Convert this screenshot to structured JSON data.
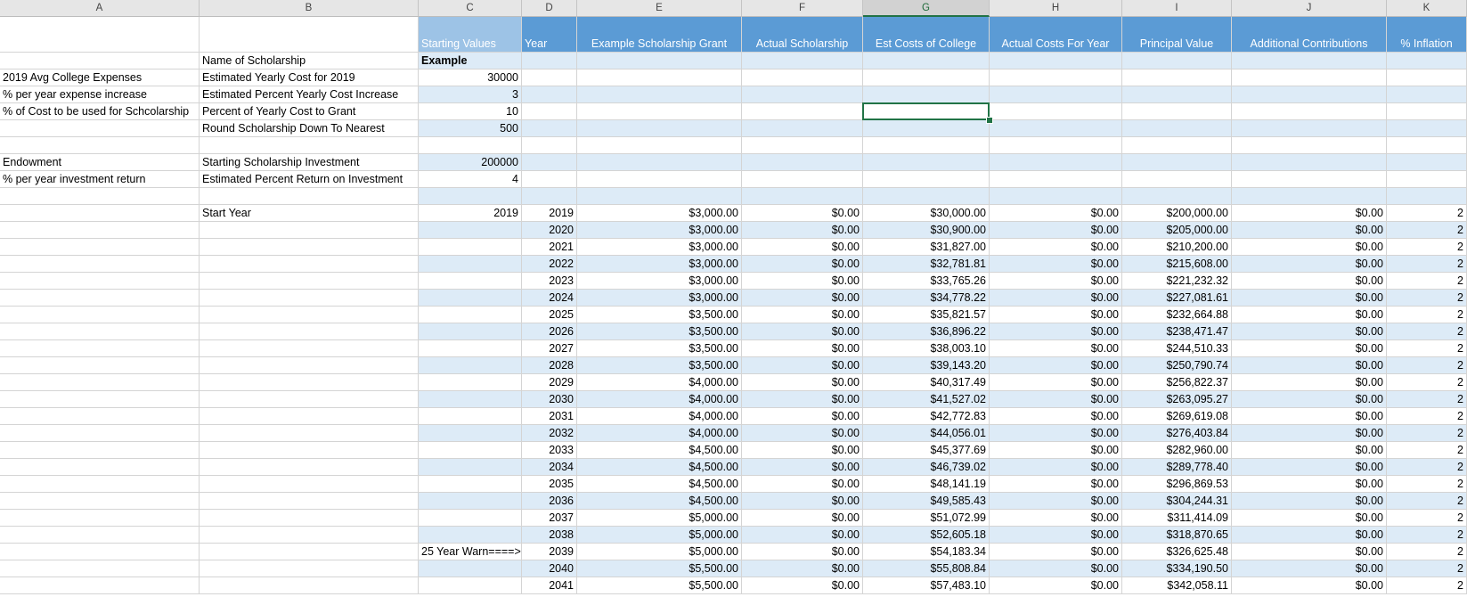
{
  "columns": [
    "A",
    "B",
    "C",
    "D",
    "E",
    "F",
    "G",
    "H",
    "I",
    "J",
    "K"
  ],
  "selected_column": "G",
  "table_headers": {
    "starting_values": "Starting Values",
    "year": "Year",
    "example_grant": "Example Scholarship Grant",
    "actual_scholarship": "Actual Scholarship",
    "est_costs": "Est Costs of College",
    "actual_costs": "Actual Costs For Year",
    "principal": "Principal Value",
    "additional": "Additional Contributions",
    "inflation": "% Inflation"
  },
  "params": {
    "name_label": "Name of Scholarship",
    "name_value": "Example",
    "avg_expenses_label": "2019 Avg College Expenses",
    "est_yearly_cost_label": "Estimated Yearly Cost for 2019",
    "est_yearly_cost_value": "30000",
    "expense_increase_label": "% per year expense increase",
    "est_percent_increase_label": "Estimated Percent Yearly Cost Increase",
    "est_percent_increase_value": "3",
    "cost_pct_label": "% of Cost to be used for Schcolarship",
    "percent_to_grant_label": "Percent of Yearly Cost to Grant",
    "percent_to_grant_value": "10",
    "round_label": "Round Scholarship Down To Nearest",
    "round_value": "500",
    "endowment_label": "Endowment",
    "starting_investment_label": "Starting Scholarship Investment",
    "starting_investment_value": "200000",
    "return_label": "% per year investment return",
    "est_return_label": "Estimated Percent Return on Investment",
    "est_return_value": "4",
    "start_year_label": "Start Year",
    "start_year_value": "2019",
    "warn_label": "25 Year Warn====>"
  },
  "rows": [
    {
      "year": "2019",
      "grant": "$3,000.00",
      "actual": "$0.00",
      "est": "$30,000.00",
      "actual_costs": "$0.00",
      "principal": "$200,000.00",
      "additional": "$0.00",
      "inflation": "2"
    },
    {
      "year": "2020",
      "grant": "$3,000.00",
      "actual": "$0.00",
      "est": "$30,900.00",
      "actual_costs": "$0.00",
      "principal": "$205,000.00",
      "additional": "$0.00",
      "inflation": "2"
    },
    {
      "year": "2021",
      "grant": "$3,000.00",
      "actual": "$0.00",
      "est": "$31,827.00",
      "actual_costs": "$0.00",
      "principal": "$210,200.00",
      "additional": "$0.00",
      "inflation": "2"
    },
    {
      "year": "2022",
      "grant": "$3,000.00",
      "actual": "$0.00",
      "est": "$32,781.81",
      "actual_costs": "$0.00",
      "principal": "$215,608.00",
      "additional": "$0.00",
      "inflation": "2"
    },
    {
      "year": "2023",
      "grant": "$3,000.00",
      "actual": "$0.00",
      "est": "$33,765.26",
      "actual_costs": "$0.00",
      "principal": "$221,232.32",
      "additional": "$0.00",
      "inflation": "2"
    },
    {
      "year": "2024",
      "grant": "$3,000.00",
      "actual": "$0.00",
      "est": "$34,778.22",
      "actual_costs": "$0.00",
      "principal": "$227,081.61",
      "additional": "$0.00",
      "inflation": "2"
    },
    {
      "year": "2025",
      "grant": "$3,500.00",
      "actual": "$0.00",
      "est": "$35,821.57",
      "actual_costs": "$0.00",
      "principal": "$232,664.88",
      "additional": "$0.00",
      "inflation": "2"
    },
    {
      "year": "2026",
      "grant": "$3,500.00",
      "actual": "$0.00",
      "est": "$36,896.22",
      "actual_costs": "$0.00",
      "principal": "$238,471.47",
      "additional": "$0.00",
      "inflation": "2"
    },
    {
      "year": "2027",
      "grant": "$3,500.00",
      "actual": "$0.00",
      "est": "$38,003.10",
      "actual_costs": "$0.00",
      "principal": "$244,510.33",
      "additional": "$0.00",
      "inflation": "2"
    },
    {
      "year": "2028",
      "grant": "$3,500.00",
      "actual": "$0.00",
      "est": "$39,143.20",
      "actual_costs": "$0.00",
      "principal": "$250,790.74",
      "additional": "$0.00",
      "inflation": "2"
    },
    {
      "year": "2029",
      "grant": "$4,000.00",
      "actual": "$0.00",
      "est": "$40,317.49",
      "actual_costs": "$0.00",
      "principal": "$256,822.37",
      "additional": "$0.00",
      "inflation": "2"
    },
    {
      "year": "2030",
      "grant": "$4,000.00",
      "actual": "$0.00",
      "est": "$41,527.02",
      "actual_costs": "$0.00",
      "principal": "$263,095.27",
      "additional": "$0.00",
      "inflation": "2"
    },
    {
      "year": "2031",
      "grant": "$4,000.00",
      "actual": "$0.00",
      "est": "$42,772.83",
      "actual_costs": "$0.00",
      "principal": "$269,619.08",
      "additional": "$0.00",
      "inflation": "2"
    },
    {
      "year": "2032",
      "grant": "$4,000.00",
      "actual": "$0.00",
      "est": "$44,056.01",
      "actual_costs": "$0.00",
      "principal": "$276,403.84",
      "additional": "$0.00",
      "inflation": "2"
    },
    {
      "year": "2033",
      "grant": "$4,500.00",
      "actual": "$0.00",
      "est": "$45,377.69",
      "actual_costs": "$0.00",
      "principal": "$282,960.00",
      "additional": "$0.00",
      "inflation": "2"
    },
    {
      "year": "2034",
      "grant": "$4,500.00",
      "actual": "$0.00",
      "est": "$46,739.02",
      "actual_costs": "$0.00",
      "principal": "$289,778.40",
      "additional": "$0.00",
      "inflation": "2"
    },
    {
      "year": "2035",
      "grant": "$4,500.00",
      "actual": "$0.00",
      "est": "$48,141.19",
      "actual_costs": "$0.00",
      "principal": "$296,869.53",
      "additional": "$0.00",
      "inflation": "2"
    },
    {
      "year": "2036",
      "grant": "$4,500.00",
      "actual": "$0.00",
      "est": "$49,585.43",
      "actual_costs": "$0.00",
      "principal": "$304,244.31",
      "additional": "$0.00",
      "inflation": "2"
    },
    {
      "year": "2037",
      "grant": "$5,000.00",
      "actual": "$0.00",
      "est": "$51,072.99",
      "actual_costs": "$0.00",
      "principal": "$311,414.09",
      "additional": "$0.00",
      "inflation": "2"
    },
    {
      "year": "2038",
      "grant": "$5,000.00",
      "actual": "$0.00",
      "est": "$52,605.18",
      "actual_costs": "$0.00",
      "principal": "$318,870.65",
      "additional": "$0.00",
      "inflation": "2"
    },
    {
      "year": "2039",
      "grant": "$5,000.00",
      "actual": "$0.00",
      "est": "$54,183.34",
      "actual_costs": "$0.00",
      "principal": "$326,625.48",
      "additional": "$0.00",
      "inflation": "2"
    },
    {
      "year": "2040",
      "grant": "$5,500.00",
      "actual": "$0.00",
      "est": "$55,808.84",
      "actual_costs": "$0.00",
      "principal": "$334,190.50",
      "additional": "$0.00",
      "inflation": "2"
    },
    {
      "year": "2041",
      "grant": "$5,500.00",
      "actual": "$0.00",
      "est": "$57,483.10",
      "actual_costs": "$0.00",
      "principal": "$342,058.11",
      "additional": "$0.00",
      "inflation": "2"
    }
  ],
  "colors": {
    "header_blue": "#5b9bd5",
    "band_blue": "#ddebf7",
    "selection_green": "#217346"
  }
}
